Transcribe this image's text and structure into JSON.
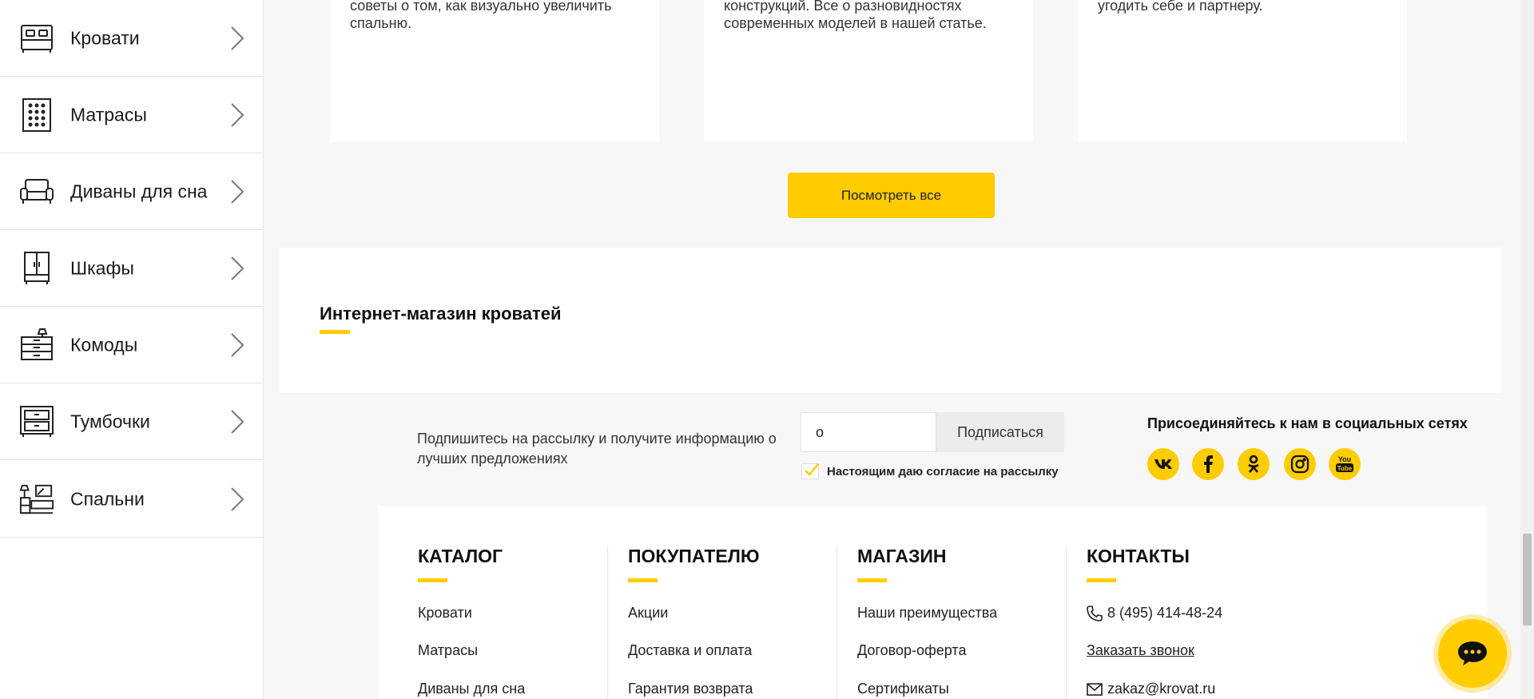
{
  "sidebar": {
    "items": [
      {
        "label": "Кровати",
        "icon": "bed-icon"
      },
      {
        "label": "Матрасы",
        "icon": "mattress-icon"
      },
      {
        "label": "Диваны для сна",
        "icon": "sofa-icon"
      },
      {
        "label": "Шкафы",
        "icon": "wardrobe-icon"
      },
      {
        "label": "Комоды",
        "icon": "dresser-icon"
      },
      {
        "label": "Тумбочки",
        "icon": "nightstand-icon"
      },
      {
        "label": "Спальни",
        "icon": "bedroom-icon"
      }
    ]
  },
  "articles": [
    {
      "text_l1": "советы о том, как визуально увеличить",
      "text_l2": "спальню."
    },
    {
      "text_l1": "конструкций. Все о разновидностях",
      "text_l2": "современных моделей в нашей статье."
    },
    {
      "text_l1": "угодить себе и партнеру.",
      "text_l2": ""
    }
  ],
  "view_all_label": "Посмотреть все",
  "shop_title": "Интернет-магазин кроватей",
  "subscribe": {
    "text": "Подпишитесь на рассылку и получите информацию о лучших предложениях",
    "input_value": "o",
    "button_label": "Подписаться",
    "consent_label": "Настоящим даю согласие на рассылку"
  },
  "social": {
    "title": "Присоединяйтесь к нам в социальных сетях",
    "icons": [
      "vk-icon",
      "facebook-icon",
      "odnoklassniki-icon",
      "instagram-icon",
      "youtube-icon"
    ],
    "youtube_text": "You\nTube"
  },
  "footer": {
    "catalog": {
      "title": "КАТАЛОГ",
      "links": [
        "Кровати",
        "Матрасы",
        "Диваны для сна"
      ]
    },
    "buyer": {
      "title": "ПОКУПАТЕЛЮ",
      "links": [
        "Акции",
        "Доставка и оплата",
        "Гарантия возврата"
      ]
    },
    "shop": {
      "title": "МАГАЗИН",
      "links": [
        "Наши преимущества",
        "Договор-оферта",
        "Сертификаты"
      ]
    },
    "contacts": {
      "title": "КОНТАКТЫ",
      "phone": "8 (495) 414-48-24",
      "callback": "Заказать звонок",
      "email": "zakaz@krovat.ru"
    }
  },
  "colors": {
    "accent": "#ffcc00",
    "background": "#f7f7f7"
  }
}
